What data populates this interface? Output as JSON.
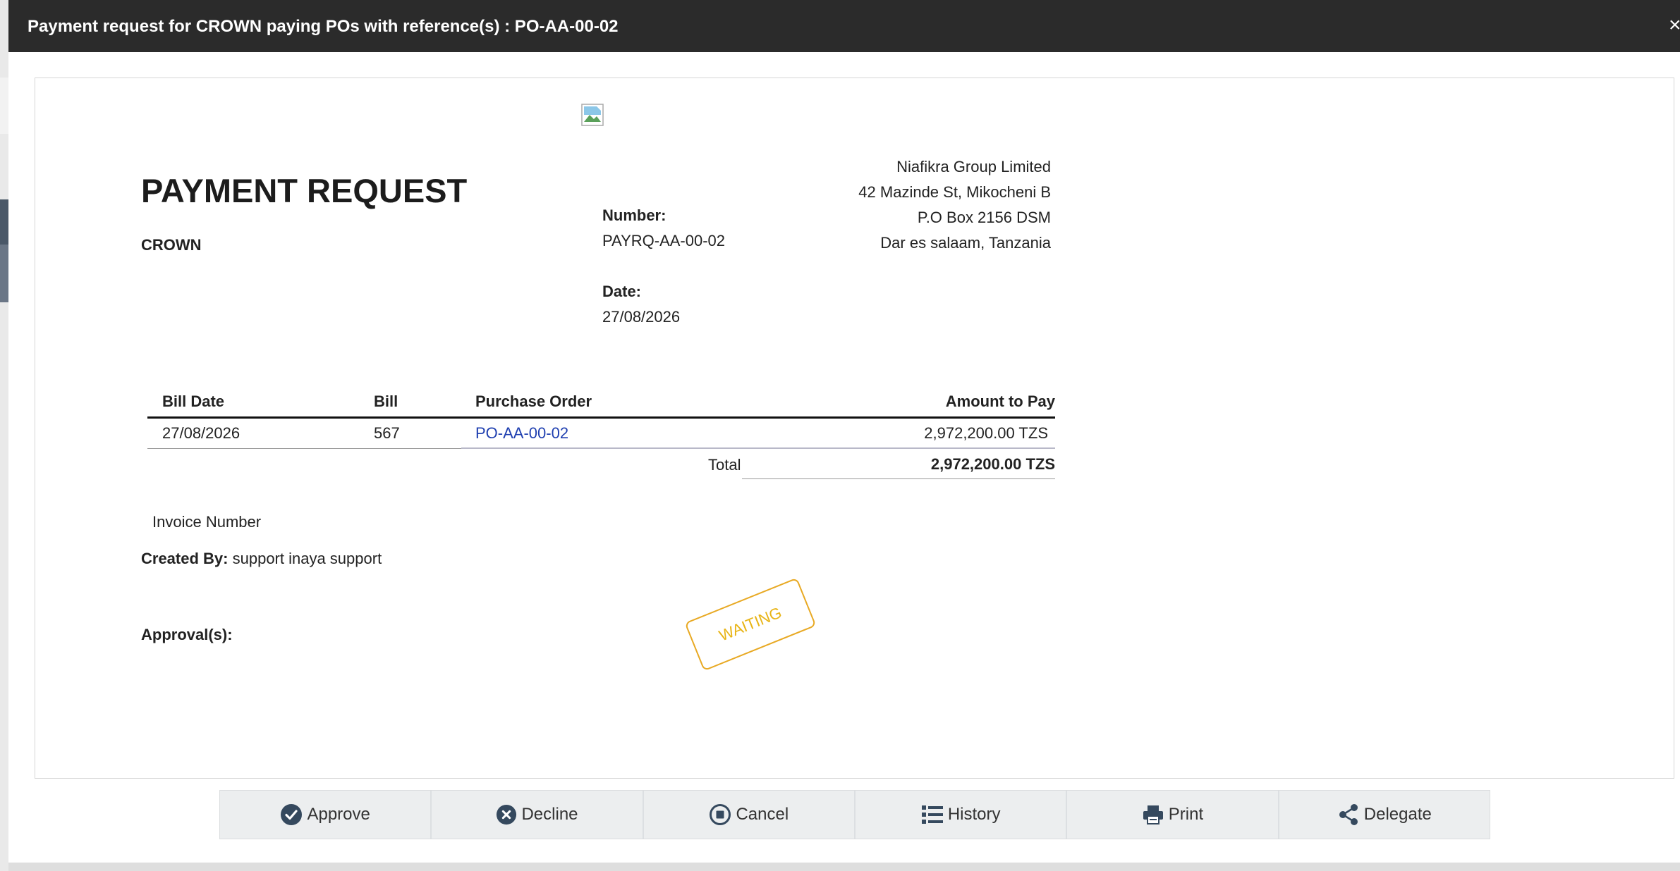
{
  "modal": {
    "title": "Payment request for CROWN paying POs with reference(s) : PO-AA-00-02",
    "close_label": "×"
  },
  "document": {
    "heading": "PAYMENT REQUEST",
    "vendor": "CROWN",
    "number_label": "Number:",
    "number_value": "PAYRQ-AA-00-02",
    "date_label": "Date:",
    "date_value": "27/08/2026",
    "company": {
      "name": "Niafikra Group Limited",
      "street": "42 Mazinde St, Mikocheni B",
      "po_box": "P.O Box 2156 DSM",
      "city": "Dar es salaam, Tanzania"
    },
    "table": {
      "headers": [
        "Bill Date",
        "Bill",
        "Purchase Order",
        "Amount to Pay"
      ],
      "rows": [
        {
          "bill_date": "27/08/2026",
          "bill": "567",
          "purchase_order": "PO-AA-00-02",
          "amount": "2,972,200.00 TZS"
        }
      ],
      "total_label": "Total",
      "total_value": "2,972,200.00 TZS"
    },
    "invoice_number_label": "Invoice Number",
    "created_by_label": "Created By:",
    "created_by_value": "support inaya support",
    "approvals_label": "Approval(s):",
    "stamp": "WAITING"
  },
  "actions": [
    {
      "label": "Approve",
      "icon": "check-circle-icon"
    },
    {
      "label": "Decline",
      "icon": "x-circle-icon"
    },
    {
      "label": "Cancel",
      "icon": "stop-circle-icon"
    },
    {
      "label": "History",
      "icon": "list-icon"
    },
    {
      "label": "Print",
      "icon": "printer-icon"
    },
    {
      "label": "Delegate",
      "icon": "share-icon"
    }
  ],
  "colors": {
    "header_bg": "#2b2b2b",
    "link": "#1f3fb0",
    "stamp": "#e8b415",
    "icon": "#35495e"
  }
}
